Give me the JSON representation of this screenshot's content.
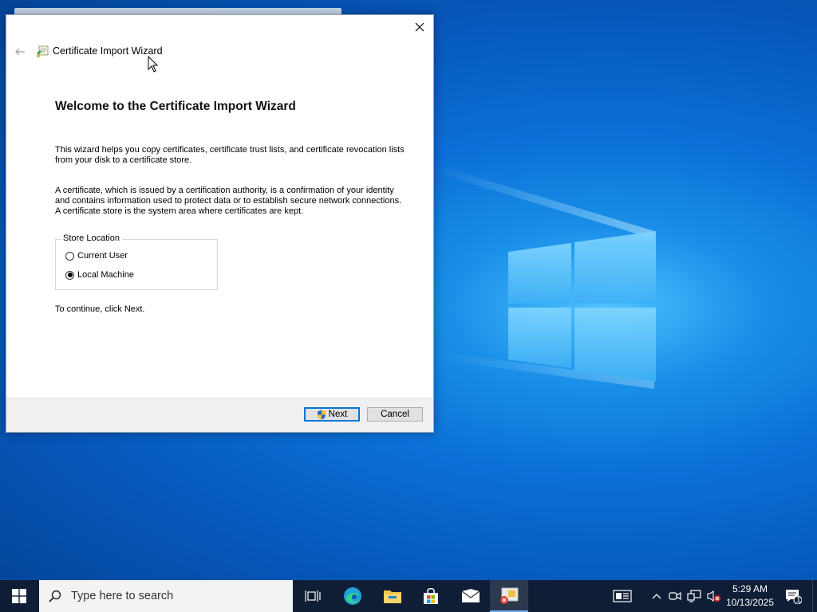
{
  "window": {
    "title": "Certificate Import Wizard",
    "heading": "Welcome to the Certificate Import Wizard",
    "paragraph1": "This wizard helps you copy certificates, certificate trust lists, and certificate revocation lists from your disk to a certificate store.",
    "paragraph2": "A certificate, which is issued by a certification authority, is a confirmation of your identity and contains information used to protect data or to establish secure network connections. A certificate store is the system area where certificates are kept.",
    "store_location": {
      "label": "Store Location",
      "options": [
        "Current User",
        "Local Machine"
      ],
      "selected": "Local Machine"
    },
    "continue_text": "To continue, click Next.",
    "next_label": "Next",
    "cancel_label": "Cancel"
  },
  "taskbar": {
    "search_placeholder": "Type here to search",
    "time": "5:29 AM",
    "date": "10/13/2025",
    "notification_count": "1"
  },
  "icons": {
    "start": "windows-logo-icon",
    "search": "search-icon",
    "task_view": "task-view-icon",
    "edge": "edge-icon",
    "explorer": "folder-icon",
    "store": "store-icon",
    "mail": "mail-icon",
    "cert_app": "certificate-app-icon",
    "news": "news-icon",
    "tray_chevron": "chevron-up-icon",
    "meet": "meet-now-icon",
    "network": "network-icon",
    "volume": "volume-muted-icon",
    "notifications": "notification-icon"
  },
  "colors": {
    "accent": "#0078d7",
    "taskbar": "#101c30",
    "desktop": "#0a6fd6"
  }
}
